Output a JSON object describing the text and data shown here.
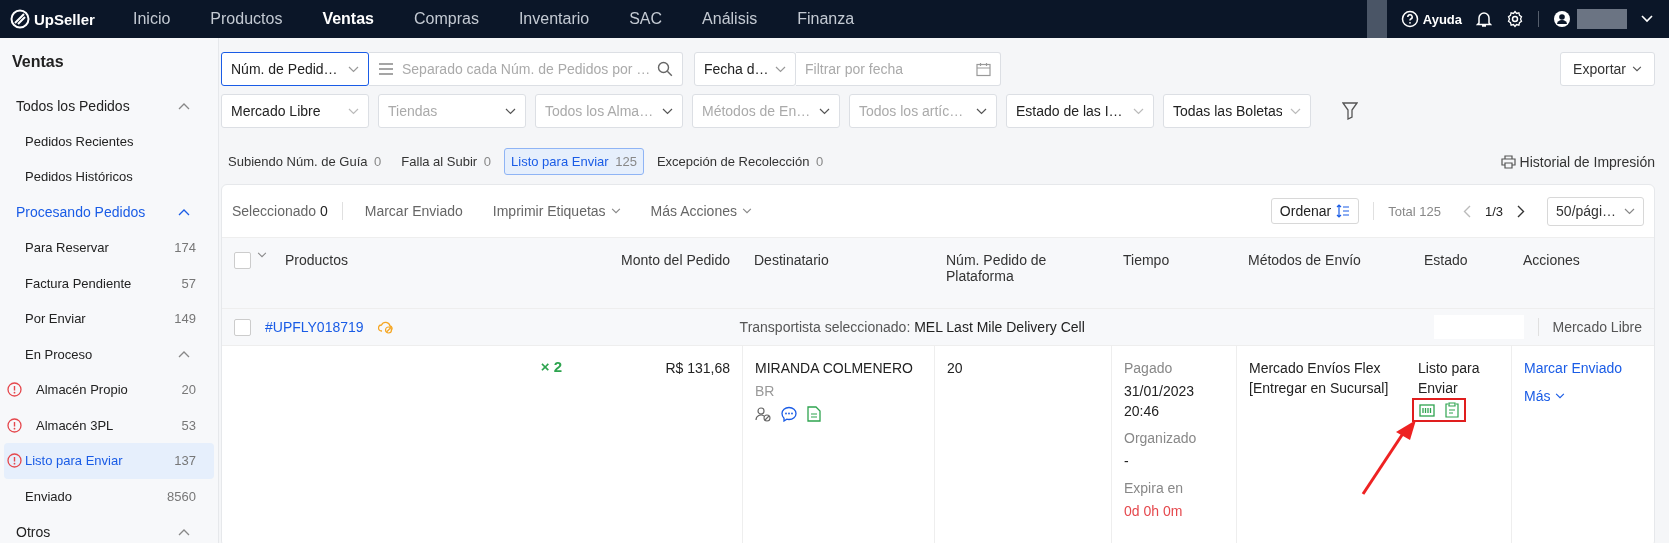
{
  "nav": {
    "logo": "UpSeller",
    "items": [
      {
        "label": "Inicio",
        "selected": false
      },
      {
        "label": "Productos",
        "selected": false
      },
      {
        "label": "Ventas",
        "selected": true
      },
      {
        "label": "Compras",
        "selected": false
      },
      {
        "label": "Inventario",
        "selected": false
      },
      {
        "label": "SAC",
        "selected": false
      },
      {
        "label": "Análisis",
        "selected": false
      },
      {
        "label": "Finanza",
        "selected": false
      }
    ],
    "help": "Ayuda"
  },
  "sidebar": {
    "title": "Ventas",
    "items": [
      {
        "label": "Todos los Pedidos",
        "expanded": true,
        "children": [
          {
            "label": "Pedidos Recientes",
            "selected": false
          },
          {
            "label": "Pedidos Históricos",
            "selected": false
          }
        ]
      },
      {
        "label": "Procesando Pedidos",
        "expanded": true,
        "children": [
          {
            "label": "Para Reservar",
            "count": "174",
            "selected": false
          },
          {
            "label": "Factura Pendiente",
            "count": "57",
            "selected": false
          },
          {
            "label": "Por Enviar",
            "count": "149",
            "selected": false
          },
          {
            "label": "En Proceso",
            "expanded": true,
            "children": [
              {
                "label": "Almacén Propio",
                "count": "20",
                "alert": true,
                "selected": false
              },
              {
                "label": "Almacén 3PL",
                "count": "53",
                "alert": true,
                "selected": false
              }
            ]
          },
          {
            "label": "Listo para Enviar",
            "count": "137",
            "alert": true,
            "selected": true
          },
          {
            "label": "Enviado",
            "count": "8560",
            "selected": false
          }
        ]
      },
      {
        "label": "Otros",
        "expanded": true
      }
    ]
  },
  "filters": {
    "row1": [
      {
        "kind": "select",
        "value": "Núm. de Pedid…",
        "focused": true
      },
      {
        "kind": "search",
        "placeholder": "Separado cada Núm. de Pedidos por …"
      },
      {
        "kind": "select",
        "value": "Fecha d…",
        "focused": false
      },
      {
        "kind": "date",
        "placeholder": "Filtrar por fecha"
      }
    ],
    "export": "Exportar",
    "row2": [
      {
        "kind": "select",
        "value": "Mercado Libre",
        "focused": false
      },
      {
        "kind": "select",
        "placeholder": "Tiendas"
      },
      {
        "kind": "select",
        "placeholder": "Todos los Alma…"
      },
      {
        "kind": "select",
        "placeholder": "Métodos de En…"
      },
      {
        "kind": "select",
        "placeholder": "Todos los artíc…"
      },
      {
        "kind": "select",
        "value": "Estado de las I…",
        "focused": false
      },
      {
        "kind": "select",
        "value": "Todas las Boletas",
        "focused": false
      }
    ]
  },
  "status_tabs": [
    {
      "label": "Subiendo Núm. de Guía",
      "count": "0",
      "selected": false
    },
    {
      "label": "Falla al Subir",
      "count": "0",
      "selected": false
    },
    {
      "label": "Listo para Enviar",
      "count": "125",
      "selected": true
    },
    {
      "label": "Excepción de Recolección",
      "count": "0",
      "selected": false
    }
  ],
  "print_history": "Historial de Impresión",
  "toolbar": {
    "selected_label": "Seleccionado",
    "selected_count": "0",
    "actions": [
      {
        "label": "Marcar Enviado",
        "dropdown": false
      },
      {
        "label": "Imprimir Etiquetas",
        "dropdown": true
      },
      {
        "label": "Más Acciones",
        "dropdown": true
      }
    ],
    "sort": "Ordenar",
    "total": "Total 125",
    "page": "1/3",
    "page_size": "50/pági…"
  },
  "table": {
    "all_checked": false,
    "columns": [
      "Productos",
      "Monto del Pedido",
      "Destinatario",
      "Núm. Pedido de Plataforma",
      "Tiempo",
      "Métodos de Envío",
      "Estado",
      "Acciones"
    ],
    "orders": [
      {
        "checked": false,
        "number": "#UPFLY018719",
        "carrier_label": "Transportista seleccionado:",
        "carrier": "MEL Last Mile Delivery Cell",
        "marketplace": "Mercado Libre",
        "quantity": "× 2",
        "amount": "R$ 131,68",
        "recipient": "MIRANDA COLMENERO",
        "country": "BR",
        "platform_order": "20",
        "times": [
          {
            "kind": "label",
            "text": "Pagado"
          },
          {
            "kind": "value",
            "text": "31/01/2023 20:46"
          },
          {
            "kind": "label",
            "text": "Organizado"
          },
          {
            "kind": "value",
            "text": "-"
          },
          {
            "kind": "label",
            "text": "Expira en"
          },
          {
            "kind": "alert",
            "text": "0d 0h 0m"
          }
        ],
        "shipping": "Mercado Envíos Flex [Entregar en Sucursal]",
        "status": "Listo para Enviar",
        "status_icons_highlighted": true,
        "actions": [
          "Marcar Enviado",
          "Más"
        ]
      }
    ]
  }
}
